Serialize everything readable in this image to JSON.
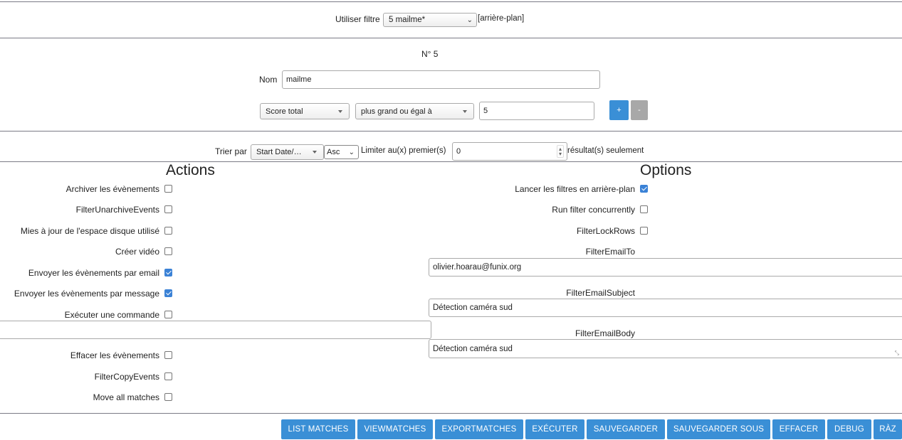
{
  "top": {
    "filter_label": "Utiliser filtre",
    "filter_value": "5 mailme*",
    "background_tag": "[arrière-plan]"
  },
  "filter": {
    "number": "N° 5",
    "name_label": "Nom",
    "name_value": "mailme",
    "term": {
      "attribute": "Score total",
      "operator": "plus grand ou égal à",
      "value": "5"
    },
    "add_label": "+",
    "remove_label": "-"
  },
  "sort": {
    "label": "Trier par",
    "field": "Start Date/…",
    "direction": "Asc",
    "limit_label": "Limiter au(x) premier(s)",
    "limit_value": "0",
    "limit_suffix": "résultat(s) seulement"
  },
  "actions": {
    "title": "Actions",
    "items": [
      {
        "label": "Archiver les évènements",
        "checked": false
      },
      {
        "label": "FilterUnarchiveEvents",
        "checked": false
      },
      {
        "label": "Mies à jour de l'espace disque utilisé",
        "checked": false
      },
      {
        "label": "Créer vidéo",
        "checked": false
      },
      {
        "label": "Envoyer les évènements par email",
        "checked": true
      },
      {
        "label": "Envoyer les évènements par message",
        "checked": true
      },
      {
        "label": "Exécuter une commande",
        "checked": false
      },
      {
        "label": "Effacer les évènements",
        "checked": false
      },
      {
        "label": "FilterCopyEvents",
        "checked": false
      },
      {
        "label": "Move all matches",
        "checked": false
      }
    ],
    "command_value": ""
  },
  "options": {
    "title": "Options",
    "items": [
      {
        "label": "Lancer les filtres en arrière-plan",
        "checked": true
      },
      {
        "label": "Run filter concurrently",
        "checked": false
      },
      {
        "label": "FilterLockRows",
        "checked": false
      }
    ],
    "email_to_label": "FilterEmailTo",
    "email_to_value": "olivier.hoarau@funix.org",
    "email_subject_label": "FilterEmailSubject",
    "email_subject_value": "Détection caméra sud",
    "email_body_label": "FilterEmailBody",
    "email_body_value": "Détection caméra sud"
  },
  "buttons": {
    "list_matches": "LIST MATCHES",
    "view_matches": "VIEWMATCHES",
    "export_matches": "EXPORTMATCHES",
    "execute": "EXÉCUTER",
    "save": "SAUVEGARDER",
    "save_as": "SAUVEGARDER SOUS",
    "delete": "EFFACER",
    "debug": "DEBUG",
    "reset": "RÀZ"
  },
  "colors": {
    "button_bg": "#3a8fd6",
    "checkbox_checked": "#3b82d6"
  }
}
